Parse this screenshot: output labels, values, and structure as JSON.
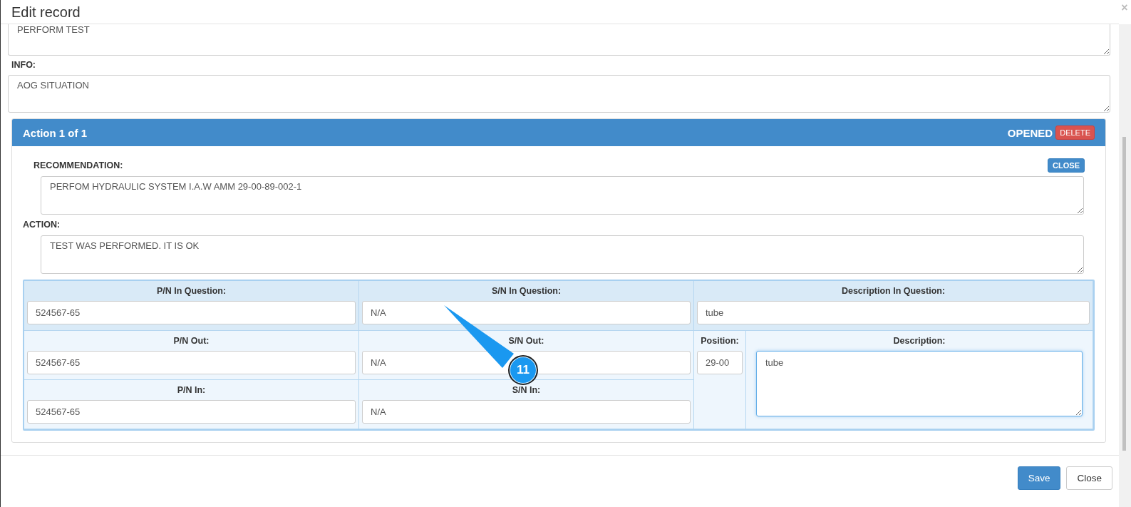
{
  "window": {
    "title": "Edit record",
    "close": "×"
  },
  "text_areas": [
    {
      "value": "PERFORM TEST"
    },
    {
      "label": "INFO:",
      "value": "AOG SITUATION"
    }
  ],
  "action_panel": {
    "title": "Action 1 of 1",
    "status": "OPENED",
    "delete_button": "DELETE",
    "recommendation": {
      "label": "RECOMMENDATION:",
      "close_button": "CLOSE",
      "value": "PERFOM HYDRAULIC SYSTEM I.A.W AMM 29-00-89-002-1"
    },
    "action": {
      "label": "ACTION:",
      "value": "TEST WAS PERFORMED. IT IS OK"
    },
    "parts_grid": [
      {
        "label": "P/N In Question:",
        "value": "524567-65",
        "kind": "input",
        "focused": false
      },
      {
        "label": "S/N In Question:",
        "value": "N/A",
        "kind": "input",
        "focused": false
      },
      {
        "label": "Description In Question:",
        "value": "tube",
        "kind": "input",
        "focused": false
      },
      {
        "label": "P/N Out:",
        "value": "524567-65",
        "kind": "input",
        "focused": false
      },
      {
        "label": "S/N Out:",
        "value": "N/A",
        "kind": "input",
        "focused": false
      },
      {
        "label": "Position:",
        "value": "29-00",
        "kind": "input",
        "focused": false
      },
      {
        "label": "Description:",
        "value": "tube",
        "kind": "textarea",
        "focused": true
      },
      {
        "label": "P/N In:",
        "value": "524567-65",
        "kind": "input",
        "focused": false
      },
      {
        "label": "S/N In:",
        "value": "N/A",
        "kind": "input",
        "focused": false
      }
    ]
  },
  "callout": {
    "number": "11"
  },
  "footer_buttons": [
    {
      "label": "Save",
      "kind": "primary"
    },
    {
      "label": "Close",
      "kind": "default"
    }
  ]
}
